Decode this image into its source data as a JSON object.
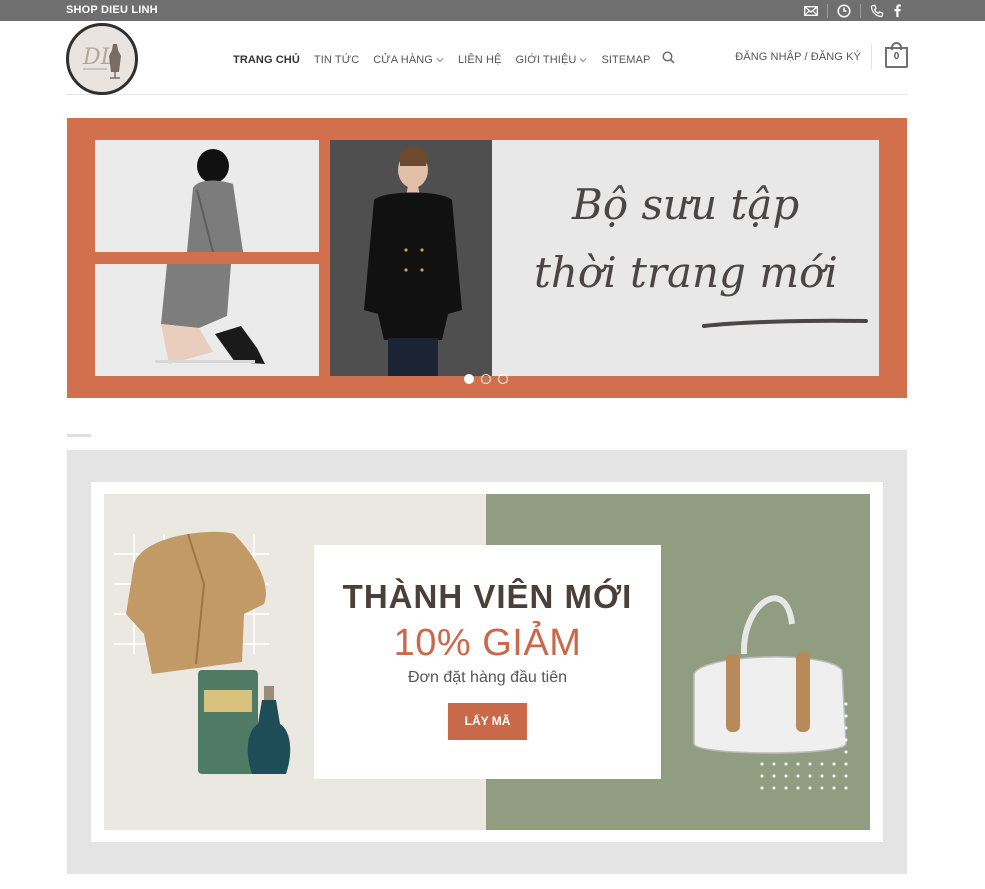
{
  "topbar": {
    "shop_name": "SHOP DIEU LINH",
    "icons": [
      "mail-icon",
      "clock-icon",
      "phone-icon",
      "facebook-icon"
    ],
    "background": "#6f6f6f"
  },
  "header": {
    "logo_text": "DL",
    "nav": [
      {
        "label": "TRANG CHỦ",
        "active": true,
        "dropdown": false
      },
      {
        "label": "TIN TỨC",
        "active": false,
        "dropdown": false
      },
      {
        "label": "CỬA HÀNG",
        "active": false,
        "dropdown": true
      },
      {
        "label": "LIÊN HỆ",
        "active": false,
        "dropdown": false
      },
      {
        "label": "GIỚI THIỆU",
        "active": false,
        "dropdown": true
      },
      {
        "label": "SITEMAP",
        "active": false,
        "dropdown": false
      }
    ],
    "login_label": "ĐĂNG NHẬP / ĐĂNG KÝ",
    "cart_count": "0"
  },
  "hero": {
    "line1": "Bộ sưu tập",
    "line2": "thời trang mới",
    "slide_count": 3,
    "active_slide": 1,
    "background": "#d2704d"
  },
  "promo": {
    "title": "THÀNH VIÊN MỚI",
    "discount": "10% GIẢM",
    "subtitle": "Đơn đặt hàng đầu tiên",
    "button_label": "LẤY MÃ",
    "accent": "#c9694a",
    "right_bg": "#919d80"
  }
}
